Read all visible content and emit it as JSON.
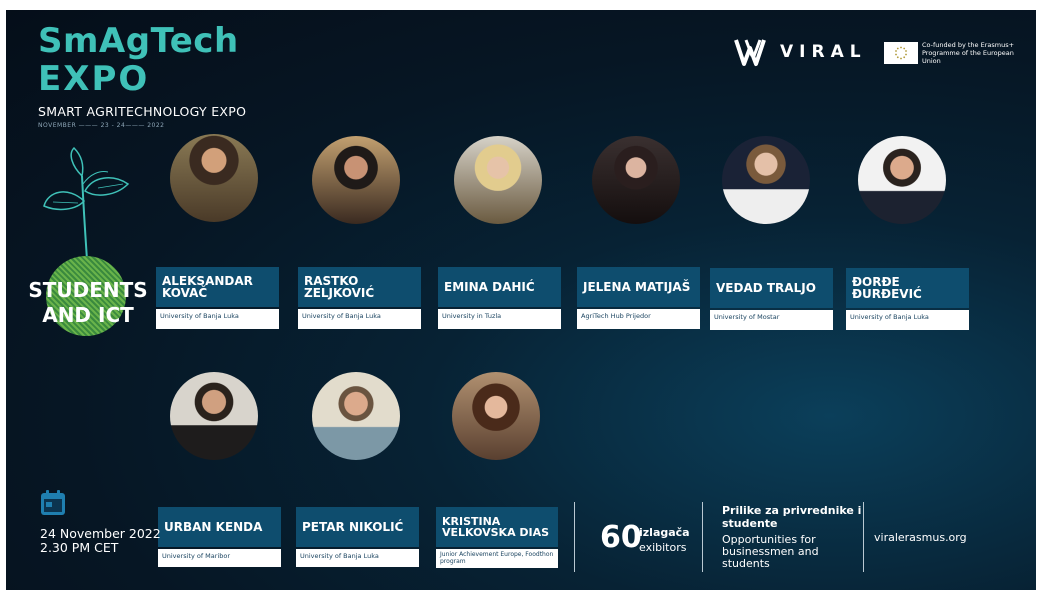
{
  "brand": {
    "line1": "SmAgTech",
    "line2": "EXPO",
    "subtitle": "SMART AGRITECHNOLOGY EXPO",
    "date_line": "NOVEMBER ——— 23 - 24——— 2022"
  },
  "partners": {
    "viral": "VIRAL",
    "eu_text": "Co-funded by the Erasmus+ Programme of the European Union"
  },
  "section_title": "STUDENTS AND ICT",
  "speakers_row1": [
    {
      "name": "ALEKSANDAR KOVAČ",
      "affiliation": "University of Banja Luka"
    },
    {
      "name": "RASTKO ZELJKOVIĆ",
      "affiliation": "University of Banja Luka"
    },
    {
      "name": "EMINA DAHIĆ",
      "affiliation": "University in Tuzla"
    },
    {
      "name": "JELENA MATIJAŠ",
      "affiliation": "AgriTech Hub Prijedor"
    },
    {
      "name": "VEDAD TRALJO",
      "affiliation": "University of Mostar"
    },
    {
      "name": "ĐORĐE ĐURĐEVIĆ",
      "affiliation": "University of Banja Luka"
    }
  ],
  "speakers_row2": [
    {
      "name": "URBAN KENDA",
      "affiliation": "University of Maribor"
    },
    {
      "name": "PETAR NIKOLIĆ",
      "affiliation": "University of Banja Luka"
    },
    {
      "name": "KRISTINA VELKOVSKA DIAS",
      "affiliation": "Junior Achievement Europe, Foodthon program"
    }
  ],
  "event": {
    "calendar_icon": "calendar-icon",
    "date": "24 November 2022",
    "time": "2.30 PM  CET"
  },
  "stats": {
    "number": "60",
    "label_local": "izlagača",
    "label_en": "exibitors"
  },
  "opportunities": {
    "local": "Prilike za privrednike i studente",
    "english": "Opportunities for businessmen and students"
  },
  "website": "viralerasmus.org",
  "colors": {
    "teal": "#3fc1b8",
    "name_box": "#0e4d6e",
    "background": "#061624"
  }
}
